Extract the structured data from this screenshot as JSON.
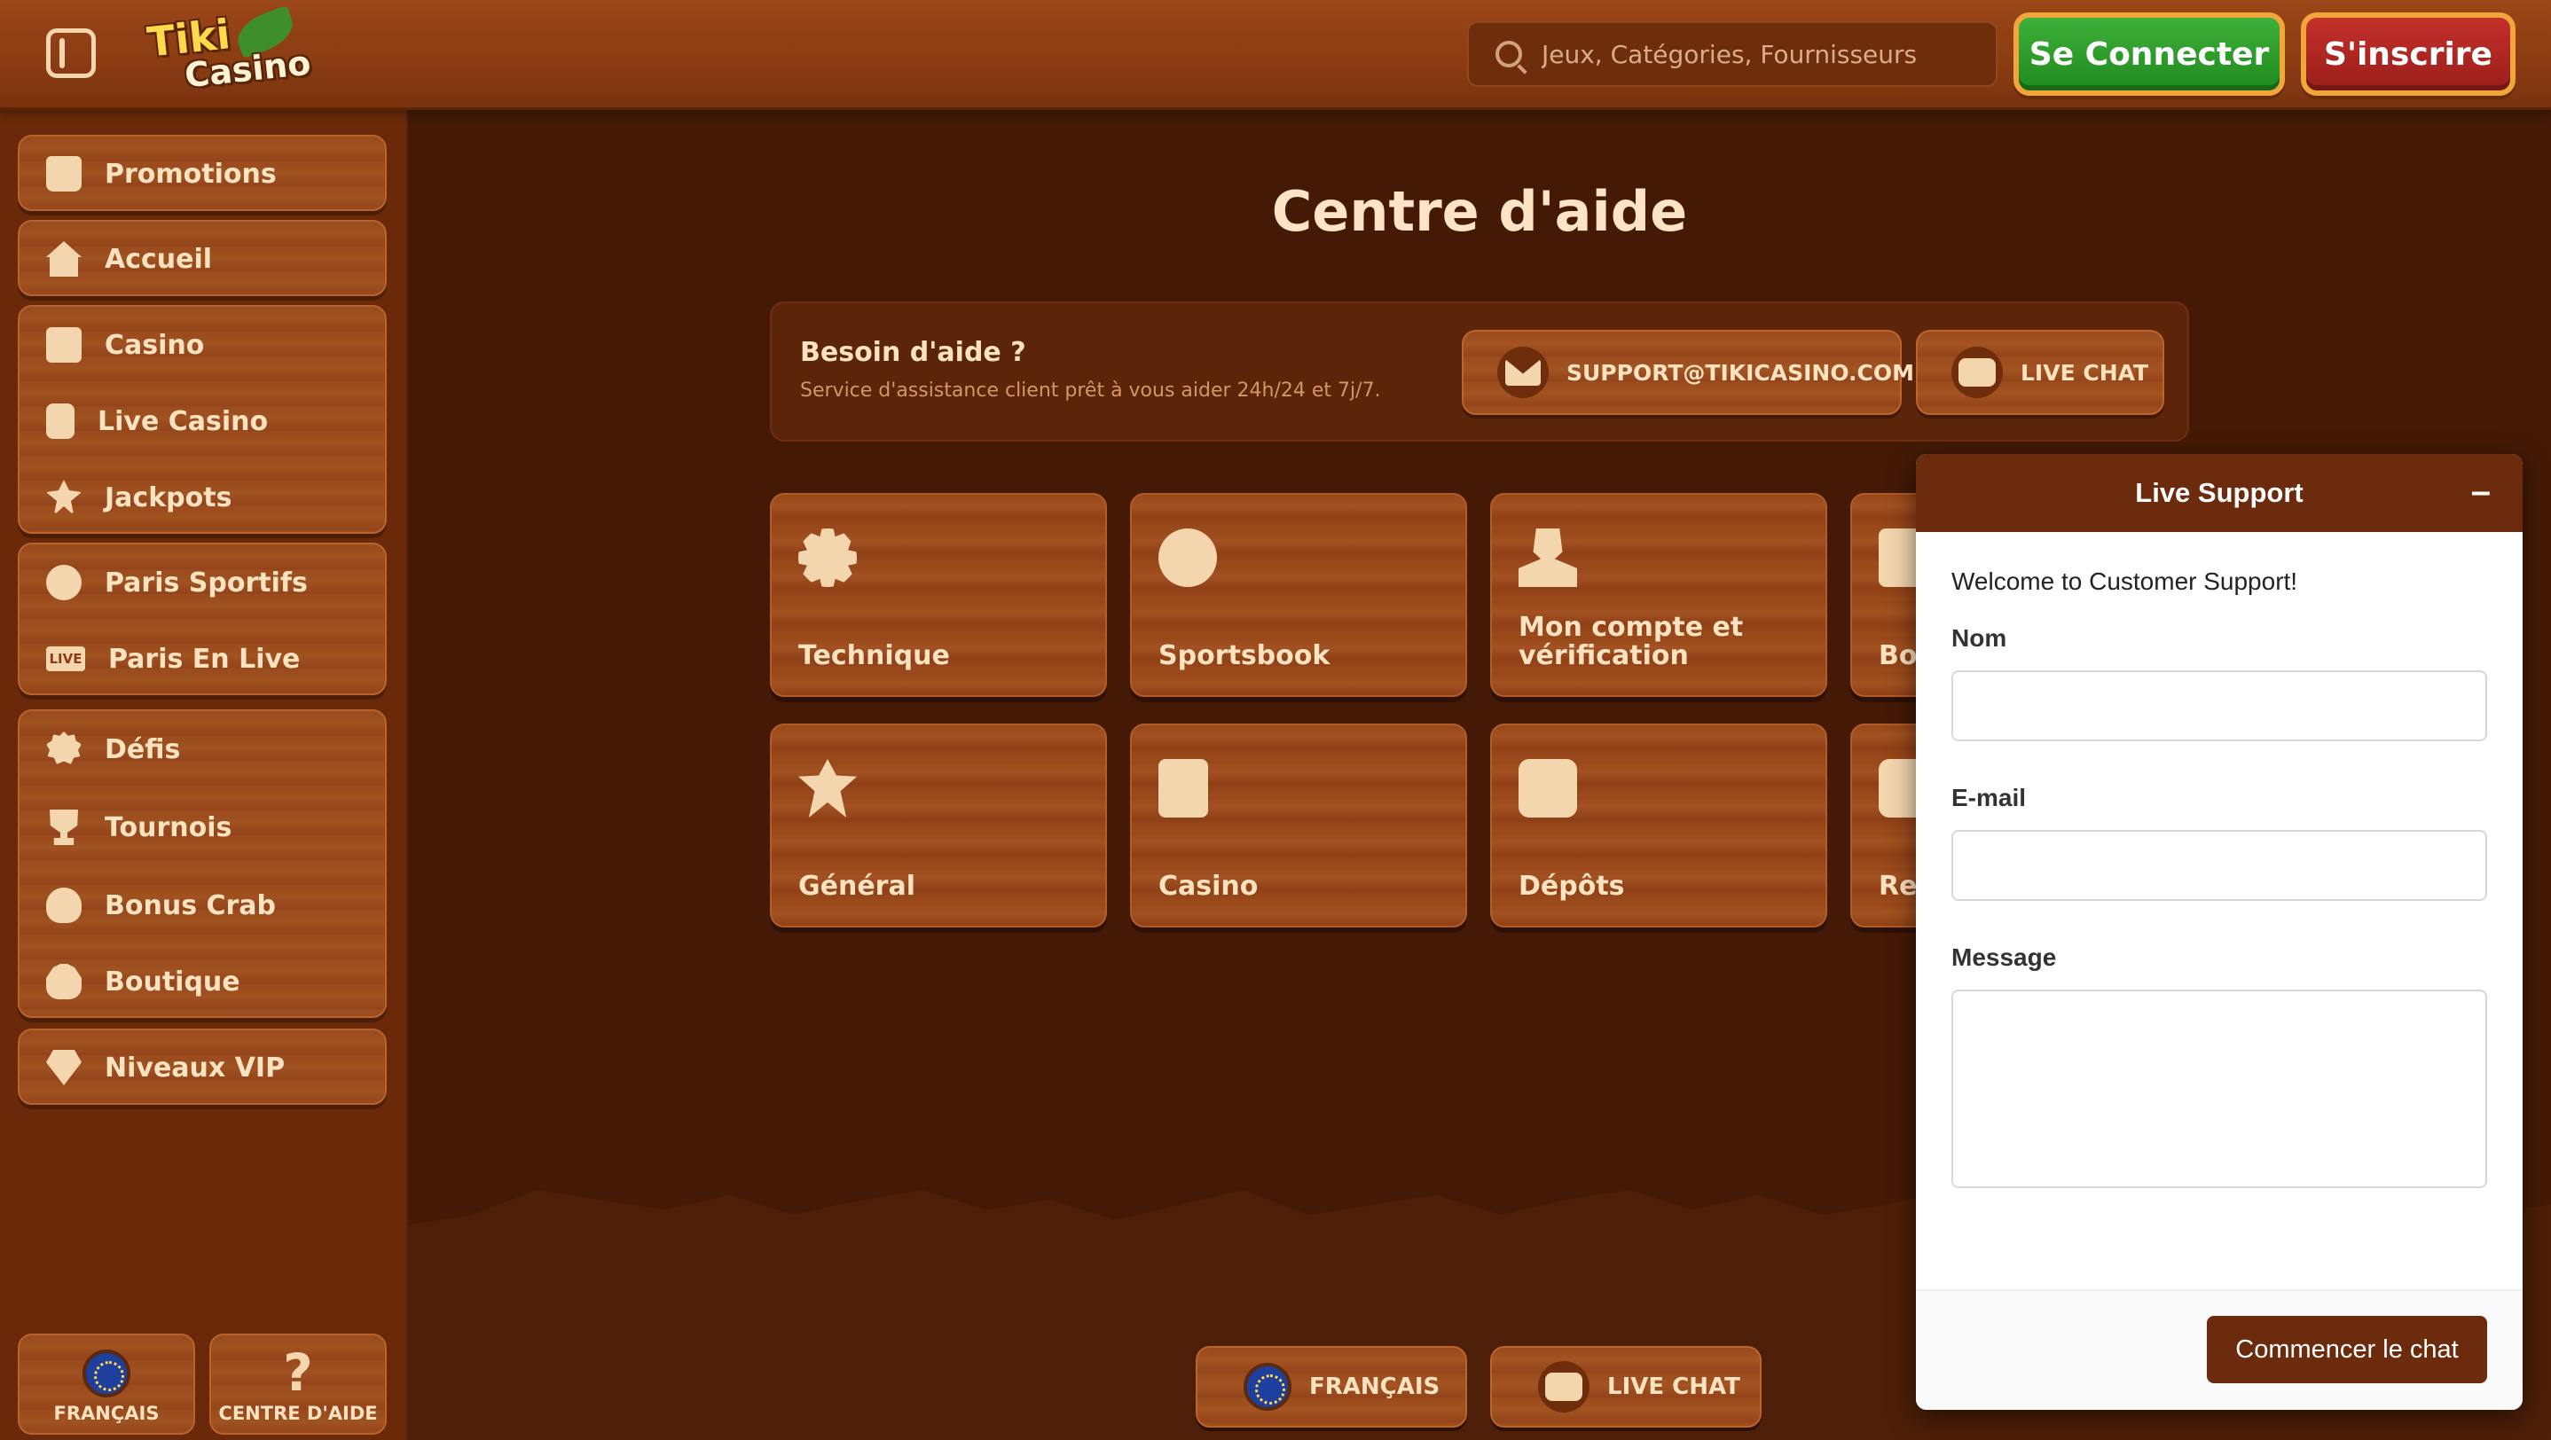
{
  "header": {
    "search_placeholder": "Jeux, Catégories, Fournisseurs",
    "login_label": "Se Connecter",
    "register_label": "S'inscrire",
    "logo_text_1": "Tiki",
    "logo_text_2": "Casino"
  },
  "sidebar": {
    "items": [
      {
        "label": "Promotions",
        "icon": "gift-icon"
      },
      {
        "label": "Accueil",
        "icon": "home-icon"
      },
      {
        "label": "Casino",
        "icon": "slot-machine-icon"
      },
      {
        "label": "Live Casino",
        "icon": "card-icon"
      },
      {
        "label": "Jackpots",
        "icon": "clover-icon"
      },
      {
        "label": "Paris Sportifs",
        "icon": "ball-icon"
      },
      {
        "label": "Paris En Live",
        "icon": "live-icon"
      },
      {
        "label": "Défis",
        "icon": "medal-icon"
      },
      {
        "label": "Tournois",
        "icon": "trophy-icon"
      },
      {
        "label": "Bonus Crab",
        "icon": "crab-icon"
      },
      {
        "label": "Boutique",
        "icon": "bag-icon"
      },
      {
        "label": "Niveaux VIP",
        "icon": "diamond-icon"
      }
    ],
    "live_badge": "LIVE",
    "bottom": {
      "language_label": "FRANÇAIS",
      "help_label": "CENTRE D'AIDE",
      "help_glyph": "?"
    }
  },
  "main": {
    "title": "Centre d'aide",
    "help_box": {
      "title": "Besoin d'aide ?",
      "subtitle": "Service d'assistance client prêt à vous aider 24h/24 et 7j/7.",
      "email_label": "SUPPORT@TIKICASINO.COM",
      "chat_label": "LIVE CHAT"
    },
    "categories": [
      {
        "label": "Technique",
        "icon": "gear-icon"
      },
      {
        "label": "Sportsbook",
        "icon": "soccer-ball-icon"
      },
      {
        "label": "Mon compte et vérification",
        "icon": "user-icon"
      },
      {
        "label": "Bo",
        "icon": "gift-icon"
      },
      {
        "label": "Général",
        "icon": "clover-icon"
      },
      {
        "label": "Casino",
        "icon": "slot-machine-icon"
      },
      {
        "label": "Dépôts",
        "icon": "coins-plus-icon"
      },
      {
        "label": "Re",
        "icon": "coins-icon"
      }
    ],
    "footer": {
      "language_label": "FRANÇAIS",
      "chat_label": "LIVE CHAT"
    }
  },
  "chat_widget": {
    "title": "Live Support",
    "minimize": "–",
    "welcome": "Welcome to Customer Support!",
    "name_label": "Nom",
    "email_label": "E-mail",
    "message_label": "Message",
    "name_value": "",
    "email_value": "",
    "message_value": "",
    "start_label": "Commencer le chat"
  }
}
